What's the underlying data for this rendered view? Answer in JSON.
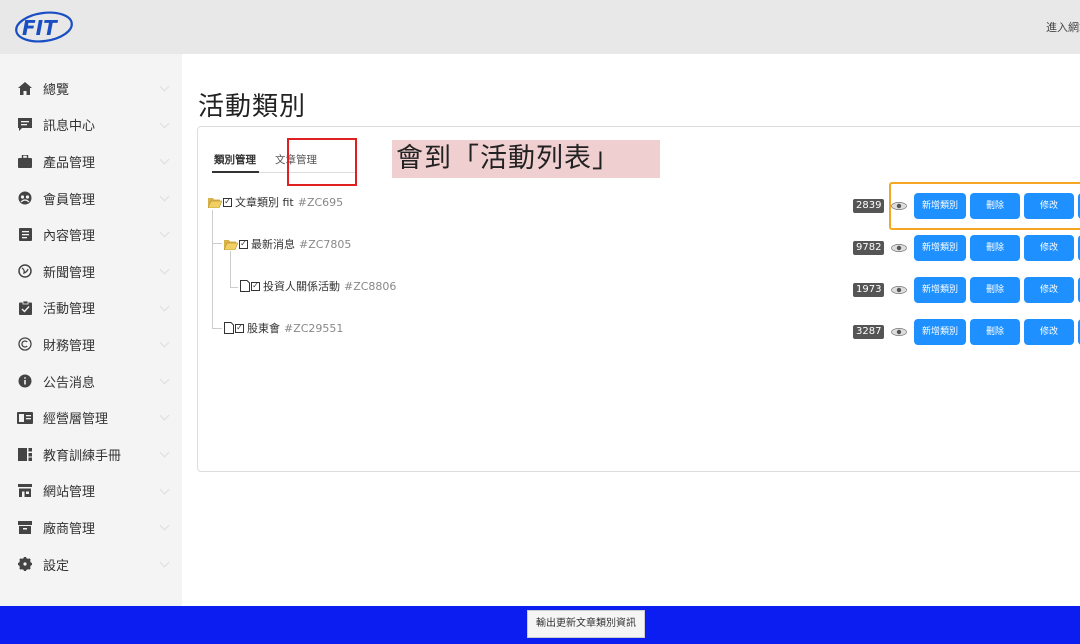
{
  "header": {
    "logo_text": "FIT",
    "top_right_link": "進入網站"
  },
  "sidebar": {
    "items": [
      {
        "label": "總覽",
        "icon": "home-icon"
      },
      {
        "label": "訊息中心",
        "icon": "message-icon"
      },
      {
        "label": "產品管理",
        "icon": "briefcase-icon"
      },
      {
        "label": "會員管理",
        "icon": "members-icon"
      },
      {
        "label": "內容管理",
        "icon": "document-icon"
      },
      {
        "label": "新聞管理",
        "icon": "globe-icon"
      },
      {
        "label": "活動管理",
        "icon": "clipboard-icon"
      },
      {
        "label": "財務管理",
        "icon": "copyright-icon"
      },
      {
        "label": "公告消息",
        "icon": "info-icon"
      },
      {
        "label": "經營層管理",
        "icon": "profile-card-icon"
      },
      {
        "label": "教育訓練手冊",
        "icon": "qr-icon"
      },
      {
        "label": "網站管理",
        "icon": "store-icon"
      },
      {
        "label": "廠商管理",
        "icon": "archive-icon"
      },
      {
        "label": "設定",
        "icon": "gear-icon"
      }
    ]
  },
  "main": {
    "title": "活動類別",
    "tabs": [
      {
        "label": "類別管理",
        "active": true
      },
      {
        "label": "文章管理",
        "active": false
      }
    ],
    "annotation": "會到「活動列表」",
    "tree": [
      {
        "label": "文章類別 fit",
        "code": "#ZC695",
        "count": "2839"
      },
      {
        "label": "最新消息",
        "code": "#ZC7805",
        "count": "9782"
      },
      {
        "label": "投資人關係活動",
        "code": "#ZC8806",
        "count": "1973"
      },
      {
        "label": "股東會",
        "code": "#ZC29551",
        "count": "3287"
      }
    ],
    "actions": {
      "add": "新增類別",
      "delete": "刪除",
      "edit": "修改"
    }
  },
  "footer": {
    "export_button": "輸出更新文章類別資訊"
  },
  "colors": {
    "primary_button": "#1e90ff",
    "footer_bar": "#0b1df0",
    "highlight_red": "#e02020",
    "highlight_orange": "#f5a623",
    "annotation_bg": "#f0cfd0"
  }
}
